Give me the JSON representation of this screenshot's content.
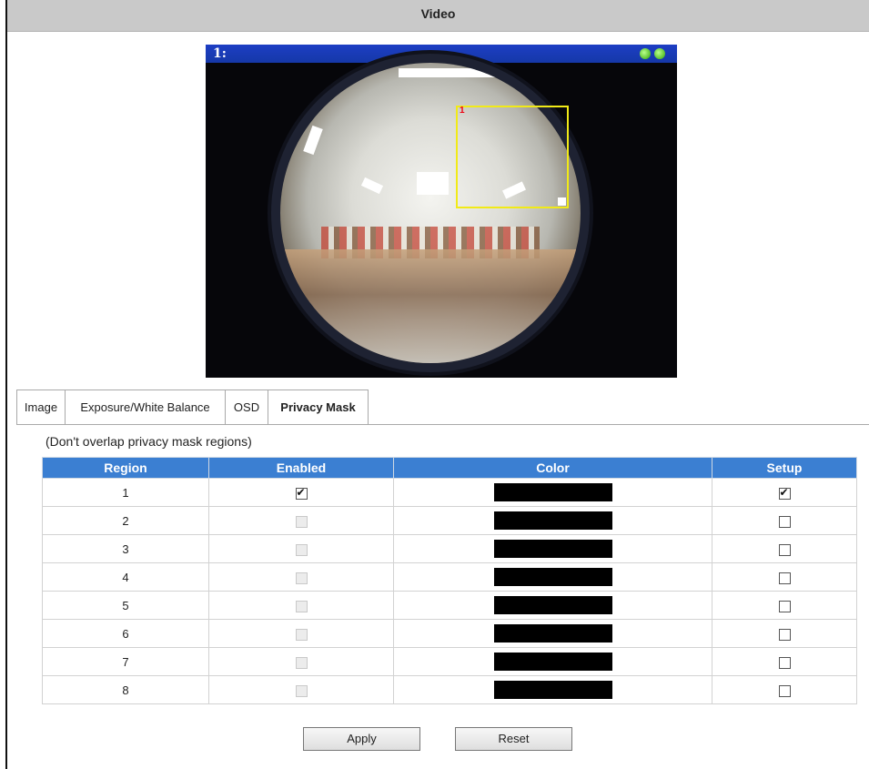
{
  "title": "Video",
  "viewer": {
    "camera_label": "1:",
    "mask_region_label": "1"
  },
  "tabs": [
    {
      "label": "Image",
      "active": false
    },
    {
      "label": "Exposure/White Balance",
      "active": false
    },
    {
      "label": "OSD",
      "active": false
    },
    {
      "label": "Privacy Mask",
      "active": true
    }
  ],
  "note": "(Don't overlap privacy mask regions)",
  "table": {
    "headers": [
      "Region",
      "Enabled",
      "Color",
      "Setup"
    ],
    "rows": [
      {
        "region": "1",
        "enabled": true,
        "enabled_disabled": false,
        "color": "#000000",
        "setup": true
      },
      {
        "region": "2",
        "enabled": false,
        "enabled_disabled": true,
        "color": "#000000",
        "setup": false
      },
      {
        "region": "3",
        "enabled": false,
        "enabled_disabled": true,
        "color": "#000000",
        "setup": false
      },
      {
        "region": "4",
        "enabled": false,
        "enabled_disabled": true,
        "color": "#000000",
        "setup": false
      },
      {
        "region": "5",
        "enabled": false,
        "enabled_disabled": true,
        "color": "#000000",
        "setup": false
      },
      {
        "region": "6",
        "enabled": false,
        "enabled_disabled": true,
        "color": "#000000",
        "setup": false
      },
      {
        "region": "7",
        "enabled": false,
        "enabled_disabled": true,
        "color": "#000000",
        "setup": false
      },
      {
        "region": "8",
        "enabled": false,
        "enabled_disabled": true,
        "color": "#000000",
        "setup": false
      }
    ]
  },
  "buttons": {
    "apply": "Apply",
    "reset": "Reset"
  },
  "colors": {
    "header_blue": "#3b7fd2",
    "title_bar": "#c9c9c9",
    "mask_outline": "#f1ea17"
  }
}
